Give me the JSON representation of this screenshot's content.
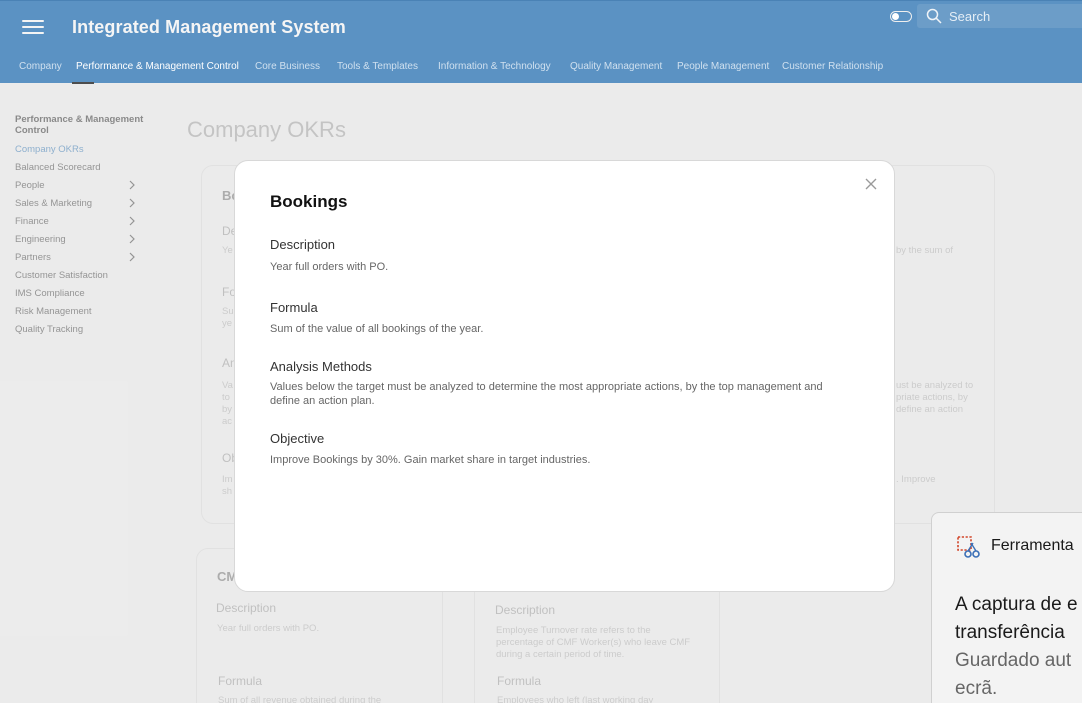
{
  "header": {
    "title": "Integrated Management System",
    "search_placeholder": "Search"
  },
  "nav": {
    "items": [
      "Company",
      "Performance & Management Control",
      "Core Business",
      "Tools & Templates",
      "Information & Technology",
      "Quality Management",
      "People Management",
      "Customer Relationship"
    ],
    "active": "Performance & Management Control"
  },
  "sidebar": {
    "heading": "Performance & Management Control",
    "items": [
      {
        "label": "Company OKRs",
        "active": true
      },
      {
        "label": "Balanced Scorecard"
      },
      {
        "label": "People",
        "expandable": true
      },
      {
        "label": "Sales & Marketing",
        "expandable": true
      },
      {
        "label": "Finance",
        "expandable": true
      },
      {
        "label": "Engineering",
        "expandable": true
      },
      {
        "label": "Partners",
        "expandable": true
      },
      {
        "label": "Customer Satisfaction"
      },
      {
        "label": "IMS Compliance"
      },
      {
        "label": "Risk Management"
      },
      {
        "label": "Quality Tracking"
      }
    ]
  },
  "page": {
    "title": "Company OKRs"
  },
  "background_cards": {
    "card1": {
      "title": "Bo",
      "desc_label": "De",
      "desc_text": "Ye",
      "formula_label": "Fo",
      "formula_text_1": "Su",
      "formula_text_2": "ye",
      "analysis_label": "An",
      "analysis_text_1": "Va",
      "analysis_text_2": "to",
      "analysis_text_3": "by",
      "analysis_text_4": "ac",
      "objective_label": "Ob",
      "objective_text_1": "Im",
      "objective_text_2": "sh"
    },
    "card2_right": {
      "desc_text": "by the sum of",
      "analysis_text_1": "ust be analyzed to",
      "analysis_text_2": "priate actions, by",
      "analysis_text_3": "define an action",
      "objective_text": ". Improve"
    },
    "card3": {
      "title": "CM",
      "desc_label": "Description",
      "desc_text": "Year full orders with PO.",
      "formula_label": "Formula",
      "formula_text": "Sum of all revenue obtained during the"
    },
    "card4": {
      "desc_label": "Description",
      "desc_text": "Employee Turnover rate refers to the percentage of CMF Worker(s) who leave CMF during a certain period of time.",
      "formula_label": "Formula",
      "formula_text": "Employees who left (last working day"
    }
  },
  "modal": {
    "title": "Bookings",
    "sections": [
      {
        "label": "Description",
        "text": "Year full orders with PO."
      },
      {
        "label": "Formula",
        "text": "Sum of the value of all bookings of the year."
      },
      {
        "label": "Analysis Methods",
        "text": "Values below the target must be analyzed to determine the most appropriate actions, by the top management and define an action plan."
      },
      {
        "label": "Objective",
        "text": "Improve Bookings by 30%. Gain market share in target industries."
      }
    ]
  },
  "toast": {
    "app_name": "Ferramenta",
    "line1": "A captura de e",
    "line2": "transferência",
    "line3": "Guardado aut",
    "line4": "ecrã."
  },
  "colors": {
    "header_bg": "#5b92c3",
    "accent_link": "#5b8fbe",
    "page_bg": "#ececec"
  }
}
